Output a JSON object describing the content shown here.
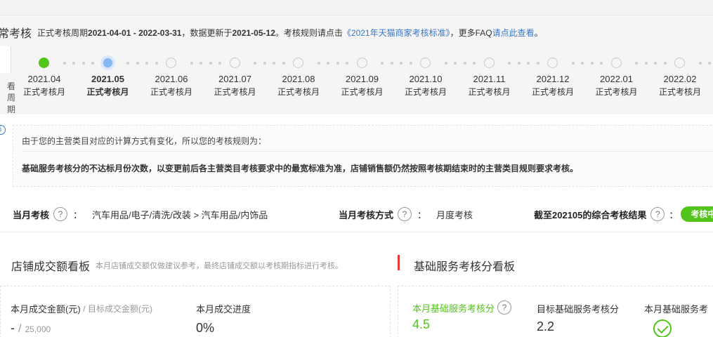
{
  "header": {
    "title": "常考核",
    "desc_prefix": "正式考核周期",
    "period": "2021-04-01 - 2022-03-31",
    "update_prefix": "，数据更新于",
    "update_date": "2021-05-12",
    "rule_prefix": "。考核规则请点击",
    "rule_link": "《2021年天猫商家考核标准》",
    "faq_prefix": "，更多FAQ",
    "faq_link": "请点此查看",
    "faq_suffix": "。"
  },
  "timeline": {
    "left_label_1": "看",
    "left_label_2": "周期",
    "months": [
      {
        "date": "2021.04",
        "label": "正式考核月",
        "state": "done"
      },
      {
        "date": "2021.05",
        "label": "正式考核月",
        "state": "current"
      },
      {
        "date": "2021.06",
        "label": "正式考核月",
        "state": "future"
      },
      {
        "date": "2021.07",
        "label": "正式考核月",
        "state": "future"
      },
      {
        "date": "2021.08",
        "label": "正式考核月",
        "state": "future"
      },
      {
        "date": "2021.09",
        "label": "正式考核月",
        "state": "future"
      },
      {
        "date": "2021.10",
        "label": "正式考核月",
        "state": "future"
      },
      {
        "date": "2021.11",
        "label": "正式考核月",
        "state": "future"
      },
      {
        "date": "2021.12",
        "label": "正式考核月",
        "state": "future"
      },
      {
        "date": "2022.01",
        "label": "正式考核月",
        "state": "future"
      },
      {
        "date": "2022.02",
        "label": "正式考核月",
        "state": "future"
      }
    ]
  },
  "notice": {
    "icon": "info-icon",
    "line1": "由于您的主营类目对应的计算方式有变化，所以您的考核规则为：",
    "line2": "基础服务考核分的不达标月份次数，以变更前后各主营类目考核要求中的最宽标准为准，店铺销售额仍然按照考核期结束时的主营类目规则要求考核。"
  },
  "assessment": {
    "month_label": "当月考核",
    "colon": "：",
    "category": "汽车用品/电子/清洗/改装 > 汽车用品/内饰品",
    "method_label": "当月考核方式",
    "method_value": "月度考核",
    "result_label": "截至202105的综合考核结果",
    "result_status": "考核中"
  },
  "boards": {
    "sales_title": "店铺成交额看板",
    "sales_note": "本月店铺成交额仅做建议参考，最终店铺成交额以考核期指标进行考核。",
    "service_title": "基础服务考核分看板"
  },
  "metrics": {
    "sales_amount_label": "本月成交金额(元)",
    "sales_target_label": "/ 目标成交金额(元)",
    "sales_amount_value": "-",
    "sales_sep": "/",
    "sales_target_value": "25,000",
    "progress_label": "本月成交进度",
    "progress_value": "0%",
    "service_score_label": "本月基础服务考核分",
    "service_score_value": "4.5",
    "target_score_label": "目标基础服务考核分",
    "target_score_value": "2.2",
    "service_status_label": "本月基础服务考"
  },
  "colors": {
    "accent_green": "#52c41a",
    "link_blue": "#3a78c8",
    "current_blue": "#86b7f2",
    "red_marker": "#e23b3b"
  }
}
